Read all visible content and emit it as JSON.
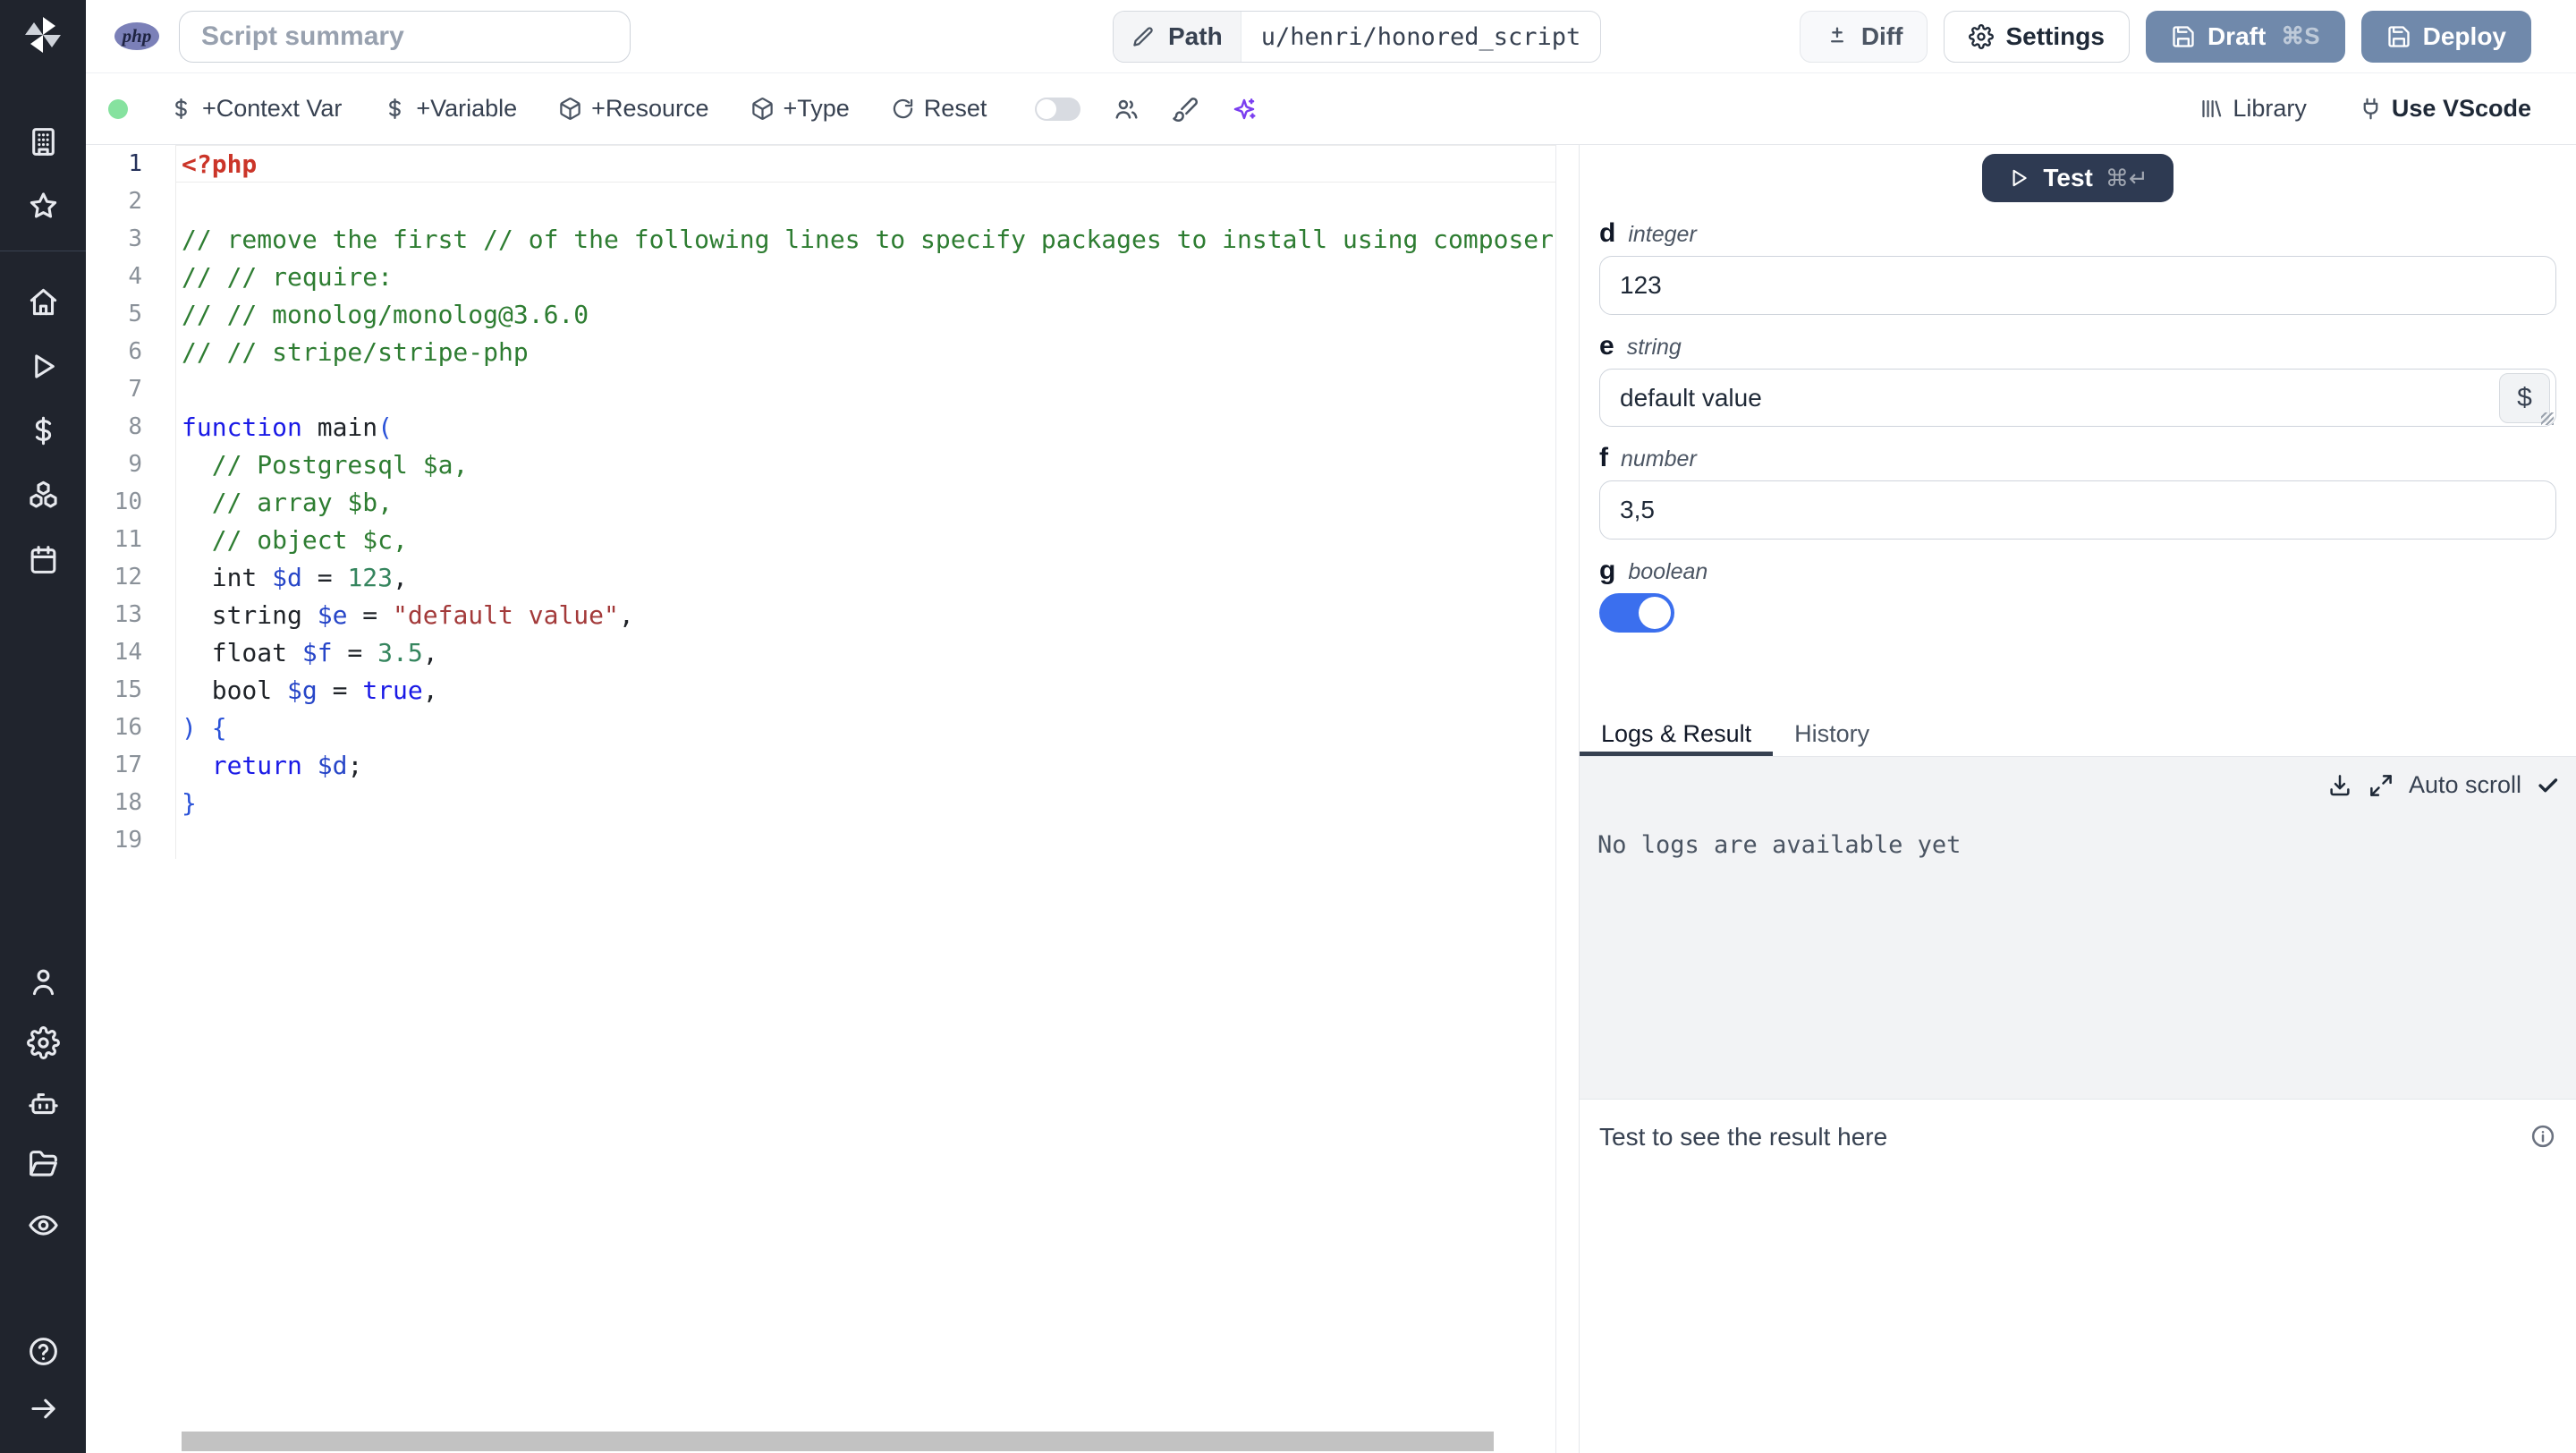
{
  "topbar": {
    "language_badge": "php",
    "summary_placeholder": "Script summary",
    "path_label": "Path",
    "path_value": "u/henri/honored_script",
    "diff_label": "Diff",
    "settings_label": "Settings",
    "draft_label": "Draft",
    "draft_shortcut": "⌘S",
    "deploy_label": "Deploy"
  },
  "toolbar": {
    "context_var_label": "+Context Var",
    "variable_label": "+Variable",
    "resource_label": "+Resource",
    "type_label": "+Type",
    "reset_label": "Reset",
    "library_label": "Library",
    "vscode_label": "Use VScode"
  },
  "sidebar": {
    "logo_icon": "windmill-logo",
    "top_items": [
      {
        "icon": "building-icon"
      },
      {
        "icon": "star-icon"
      }
    ],
    "nav_items": [
      {
        "icon": "home-icon"
      },
      {
        "icon": "play-icon"
      },
      {
        "icon": "dollar-icon"
      },
      {
        "icon": "cubes-icon"
      },
      {
        "icon": "calendar-icon"
      }
    ],
    "secondary_items": [
      {
        "icon": "user-icon"
      },
      {
        "icon": "gear-icon"
      },
      {
        "icon": "robot-icon"
      },
      {
        "icon": "folder-icon"
      },
      {
        "icon": "eye-icon"
      }
    ],
    "footer_items": [
      {
        "icon": "help-icon"
      },
      {
        "icon": "arrow-right-icon"
      }
    ]
  },
  "editor": {
    "lines": [
      {
        "n": 1,
        "active": true,
        "tokens": [
          {
            "t": "<?php",
            "c": "tag"
          }
        ]
      },
      {
        "n": 2,
        "tokens": []
      },
      {
        "n": 3,
        "tokens": [
          {
            "t": "// remove the first // of the following lines to specify packages to install using composer",
            "c": "cm"
          }
        ]
      },
      {
        "n": 4,
        "tokens": [
          {
            "t": "// // require:",
            "c": "cm"
          }
        ]
      },
      {
        "n": 5,
        "tokens": [
          {
            "t": "// // monolog/monolog@3.6.0",
            "c": "cm"
          }
        ]
      },
      {
        "n": 6,
        "tokens": [
          {
            "t": "// // stripe/stripe-php",
            "c": "cm"
          }
        ]
      },
      {
        "n": 7,
        "tokens": []
      },
      {
        "n": 8,
        "tokens": [
          {
            "t": "function",
            "c": "kw"
          },
          {
            "t": " ",
            "c": "pl"
          },
          {
            "t": "main",
            "c": "fn"
          },
          {
            "t": "(",
            "c": "br"
          }
        ]
      },
      {
        "n": 9,
        "tokens": [
          {
            "t": "  ",
            "c": "pl"
          },
          {
            "t": "// Postgresql $a,",
            "c": "cm"
          }
        ]
      },
      {
        "n": 10,
        "tokens": [
          {
            "t": "  ",
            "c": "pl"
          },
          {
            "t": "// array $b,",
            "c": "cm"
          }
        ]
      },
      {
        "n": 11,
        "tokens": [
          {
            "t": "  ",
            "c": "pl"
          },
          {
            "t": "// object $c,",
            "c": "cm"
          }
        ]
      },
      {
        "n": 12,
        "tokens": [
          {
            "t": "  int ",
            "c": "pl"
          },
          {
            "t": "$d",
            "c": "v"
          },
          {
            "t": " = ",
            "c": "pl"
          },
          {
            "t": "123",
            "c": "n"
          },
          {
            "t": ",",
            "c": "pl"
          }
        ]
      },
      {
        "n": 13,
        "tokens": [
          {
            "t": "  string ",
            "c": "pl"
          },
          {
            "t": "$e",
            "c": "v"
          },
          {
            "t": " = ",
            "c": "pl"
          },
          {
            "t": "\"default value\"",
            "c": "s"
          },
          {
            "t": ",",
            "c": "pl"
          }
        ]
      },
      {
        "n": 14,
        "tokens": [
          {
            "t": "  float ",
            "c": "pl"
          },
          {
            "t": "$f",
            "c": "v"
          },
          {
            "t": " = ",
            "c": "pl"
          },
          {
            "t": "3.5",
            "c": "n"
          },
          {
            "t": ",",
            "c": "pl"
          }
        ]
      },
      {
        "n": 15,
        "tokens": [
          {
            "t": "  bool ",
            "c": "pl"
          },
          {
            "t": "$g",
            "c": "v"
          },
          {
            "t": " = ",
            "c": "pl"
          },
          {
            "t": "true",
            "c": "kw"
          },
          {
            "t": ",",
            "c": "pl"
          }
        ]
      },
      {
        "n": 16,
        "tokens": [
          {
            "t": ") {",
            "c": "br"
          }
        ]
      },
      {
        "n": 17,
        "tokens": [
          {
            "t": "  ",
            "c": "pl"
          },
          {
            "t": "return",
            "c": "kw"
          },
          {
            "t": " ",
            "c": "pl"
          },
          {
            "t": "$d",
            "c": "v"
          },
          {
            "t": ";",
            "c": "pl"
          }
        ]
      },
      {
        "n": 18,
        "tokens": [
          {
            "t": "}",
            "c": "br"
          }
        ]
      },
      {
        "n": 19,
        "tokens": []
      }
    ]
  },
  "panel": {
    "test_button": {
      "label": "Test",
      "shortcut": "⌘↵"
    },
    "fields": [
      {
        "name": "d",
        "type": "integer",
        "value": "123",
        "control": "input"
      },
      {
        "name": "e",
        "type": "string",
        "value": "default value",
        "control": "textarea",
        "dollar_button": "$"
      },
      {
        "name": "f",
        "type": "number",
        "value": "3,5",
        "control": "input"
      },
      {
        "name": "g",
        "type": "boolean",
        "value": "true",
        "control": "toggle"
      }
    ],
    "tabs": [
      {
        "label": "Logs & Result",
        "active": true
      },
      {
        "label": "History",
        "active": false
      }
    ],
    "auto_scroll_label": "Auto scroll",
    "logs_empty_text": "No logs are available yet",
    "result_placeholder": "Test to see the result here"
  },
  "colors": {
    "sidebar_bg": "#20242d",
    "primary_button": "#7089ab",
    "test_button": "#2e3a52",
    "toggle_on": "#3b6fee",
    "status_green": "#86e29f",
    "ai_purple": "#7a3ef0",
    "tab_underline": "#374151",
    "logs_bg": "#f2f3f5",
    "scrollbar": "#c2c2c2",
    "php_badge": "#7b80b8",
    "syn_tag": "#cb3529",
    "syn_comment": "#2e7d32",
    "syn_keyword": "#1a1ae6",
    "syn_variable": "#2746c8",
    "syn_number": "#35855e",
    "syn_string": "#a33a3a",
    "syn_bracket": "#2a52d8",
    "syn_plain": "#1f2328"
  }
}
